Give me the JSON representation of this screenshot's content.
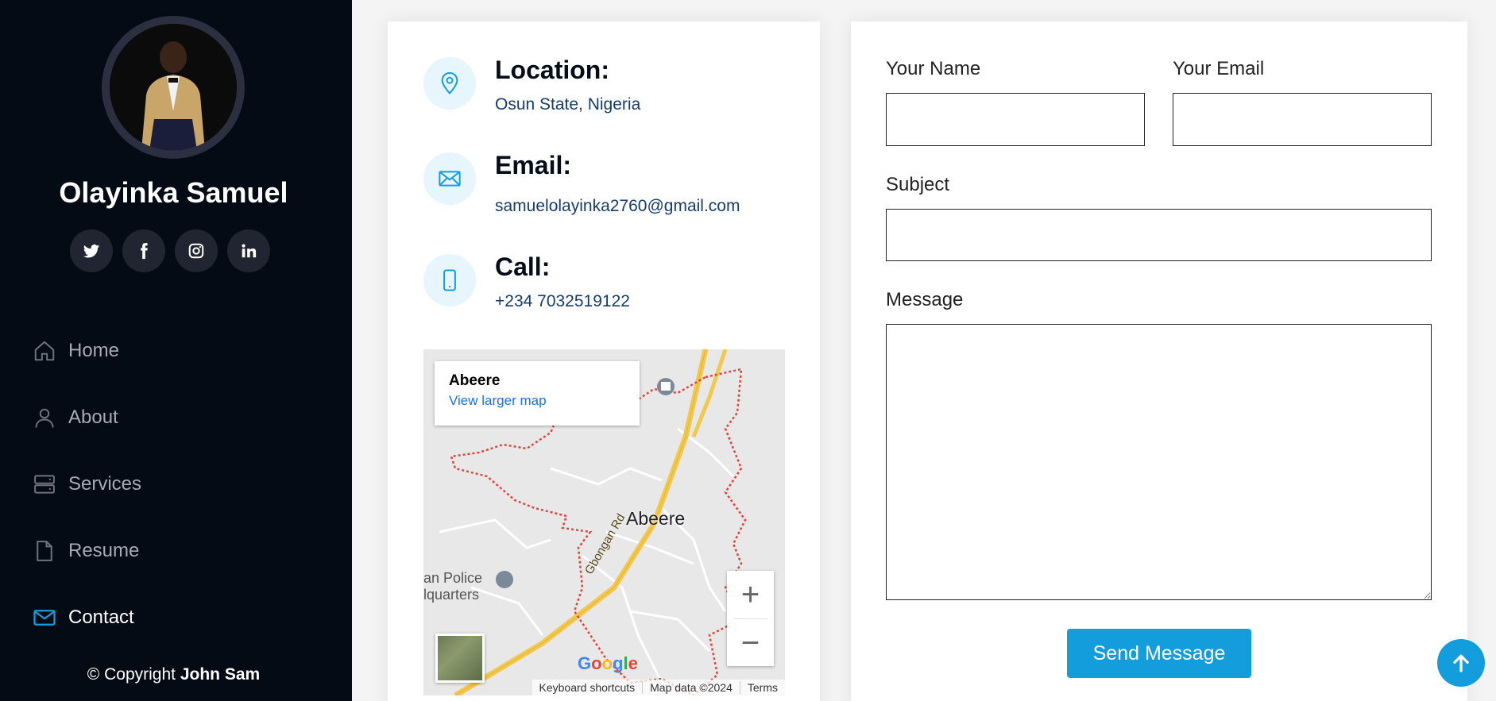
{
  "profile": {
    "name": "Olayinka Samuel"
  },
  "socials": [
    {
      "icon": "twitter-icon",
      "glyph": "t"
    },
    {
      "icon": "facebook-icon",
      "glyph": "f"
    },
    {
      "icon": "instagram-icon",
      "glyph": "◎"
    },
    {
      "icon": "linkedin-icon",
      "glyph": "in"
    }
  ],
  "nav": [
    {
      "label": "Home",
      "icon": "home-icon"
    },
    {
      "label": "About",
      "icon": "person-icon"
    },
    {
      "label": "Services",
      "icon": "server-icon"
    },
    {
      "label": "Resume",
      "icon": "document-icon"
    },
    {
      "label": "Contact",
      "icon": "envelope-icon",
      "active": true
    }
  ],
  "copyright": {
    "prefix": "© Copyright",
    "owner": "John Sam"
  },
  "info": {
    "location_title": "Location:",
    "location_text": "Osun State, Nigeria",
    "email_title": "Email:",
    "email_text": "samuelolayinka2760@gmail.com",
    "call_title": "Call:",
    "call_text": "+234 7032519122"
  },
  "map": {
    "place": "Abeere",
    "link": "View larger map",
    "center_label": "Abeere",
    "road_label": "Gbongan Rd",
    "police_label": "an Police\nlquarters",
    "zoom_in": "+",
    "zoom_out": "−",
    "logo": "Google",
    "footer": [
      "Keyboard shortcuts",
      "Map data ©2024",
      "Terms"
    ]
  },
  "form": {
    "name_label": "Your Name",
    "email_label": "Your Email",
    "subject_label": "Subject",
    "message_label": "Message",
    "name_value": "",
    "email_value": "",
    "subject_value": "",
    "message_value": "",
    "submit_label": "Send Message"
  },
  "colors": {
    "accent": "#149ddd",
    "sidebar": "#040b14",
    "heading": "#050d18",
    "text": "#173b6c"
  }
}
